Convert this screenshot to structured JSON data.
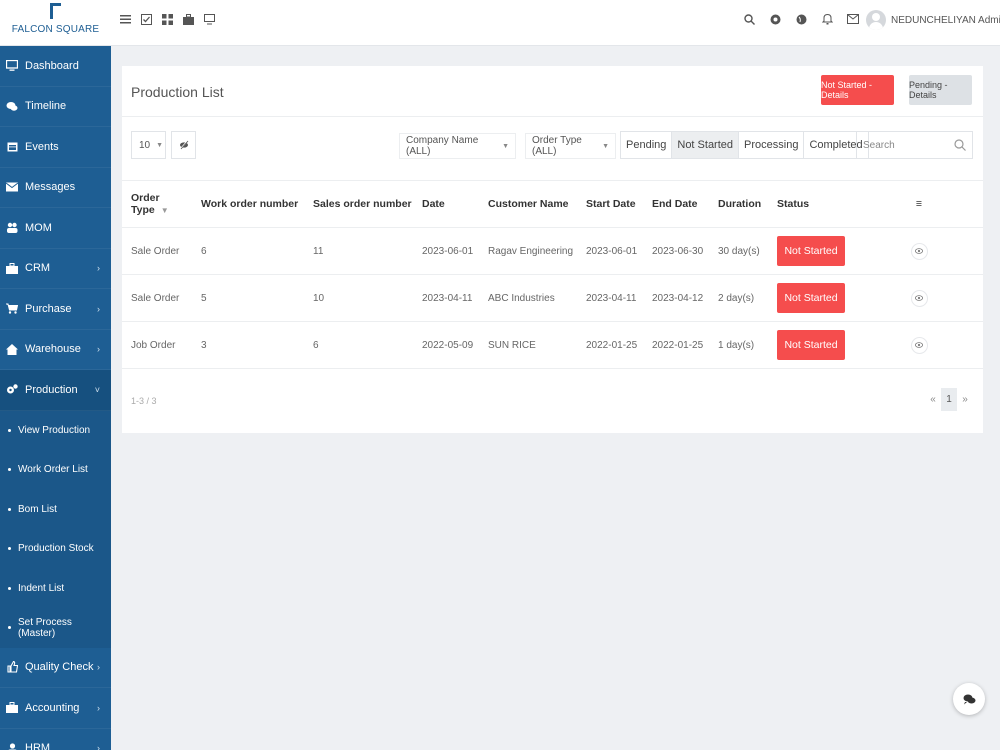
{
  "brand": {
    "name": "FALCON SQUARE"
  },
  "topbar": {
    "user_name": "NEDUNCHELIYAN Admin ▾",
    "left_icons": [
      "list-icon",
      "check-square-icon",
      "grid-icon",
      "briefcase-icon",
      "monitor-icon"
    ],
    "right_icons": [
      "search-icon",
      "settings-icon",
      "globe-icon",
      "bell-icon",
      "mail-icon"
    ]
  },
  "sidebar": {
    "items": [
      {
        "label": "Dashboard",
        "icon": "monitor-icon",
        "chevron": ""
      },
      {
        "label": "Timeline",
        "icon": "chat-icon",
        "chevron": ""
      },
      {
        "label": "Events",
        "icon": "calendar-icon",
        "chevron": ""
      },
      {
        "label": "Messages",
        "icon": "envelope-icon",
        "chevron": ""
      },
      {
        "label": "MOM",
        "icon": "people-icon",
        "chevron": ""
      },
      {
        "label": "CRM",
        "icon": "briefcase-icon",
        "chevron": "›"
      },
      {
        "label": "Purchase",
        "icon": "cart-icon",
        "chevron": "›"
      },
      {
        "label": "Warehouse",
        "icon": "home-icon",
        "chevron": "›"
      },
      {
        "label": "Production",
        "icon": "cogs-icon",
        "chevron": "˅"
      }
    ],
    "sub_items": [
      {
        "label": "View Production"
      },
      {
        "label": "Work Order List"
      },
      {
        "label": "Bom List"
      },
      {
        "label": "Production Stock"
      },
      {
        "label": "Indent List"
      },
      {
        "label": "Set Process (Master)"
      }
    ],
    "items_after": [
      {
        "label": "Quality Check",
        "icon": "thumb-icon",
        "chevron": "›"
      },
      {
        "label": "Accounting",
        "icon": "briefcase-icon",
        "chevron": "›"
      },
      {
        "label": "HRM",
        "icon": "user-icon",
        "chevron": "›"
      }
    ]
  },
  "card": {
    "title": "Production List",
    "btn_not_started": "Not Started - Details",
    "btn_pending": "Pending - Details",
    "page_length": "10",
    "company_filter": "Company Name (ALL)",
    "order_type_filter": "Order Type (ALL)",
    "segments": [
      {
        "label": "Pending",
        "selected": false
      },
      {
        "label": "Not Started",
        "selected": true
      },
      {
        "label": "Processing",
        "selected": false
      },
      {
        "label": "Completed",
        "selected": false
      }
    ],
    "search_placeholder": "Search"
  },
  "table": {
    "columns": [
      "Order Type",
      "Work order number",
      "Sales order number",
      "Date",
      "Customer Name",
      "Start Date",
      "End Date",
      "Duration",
      "Status",
      "≡"
    ],
    "rows": [
      [
        "Sale Order",
        "6",
        "11",
        "2023-06-01",
        "Ragav Engineering",
        "2023-06-01",
        "2023-06-30",
        "30 day(s)",
        "Not Started"
      ],
      [
        "Sale Order",
        "5",
        "10",
        "2023-04-11",
        "ABC Industries",
        "2023-04-11",
        "2023-04-12",
        "2 day(s)",
        "Not Started"
      ],
      [
        "Job Order",
        "3",
        "6",
        "2022-05-09",
        "SUN RICE",
        "2022-01-25",
        "2022-01-25",
        "1 day(s)",
        "Not Started"
      ]
    ]
  },
  "footer": {
    "info": "1-3 / 3",
    "prev": "«",
    "page": "1",
    "next": "»"
  },
  "colors": {
    "sidebar": "#1e5e93",
    "danger": "#f54d4d"
  }
}
